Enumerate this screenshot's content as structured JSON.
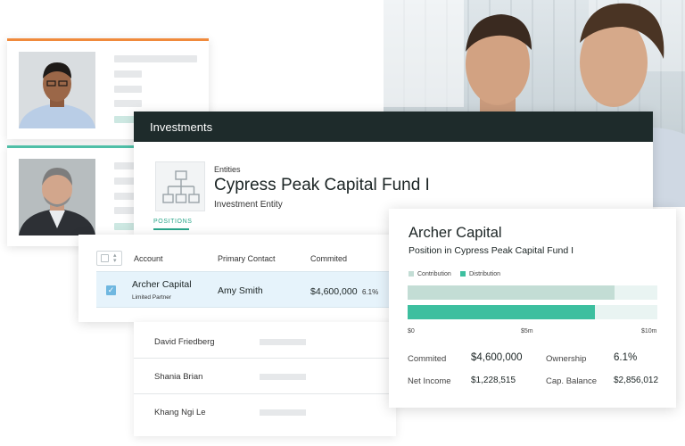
{
  "investments": {
    "title": "Investments",
    "entities_label": "Entities",
    "fund_name": "Cypress Peak Capital Fund I",
    "entity_type": "Investment Entity",
    "tab_positions": "POSITIONS"
  },
  "table": {
    "columns": [
      "Account",
      "Primary Contact",
      "Commited"
    ],
    "selected_row": {
      "account": "Archer Capital",
      "account_type": "Limited Partner",
      "contact": "Amy Smith",
      "commited": "$4,600,000",
      "pct": "6.1%"
    }
  },
  "list": [
    "David Friedberg",
    "Shania Brian",
    "Khang Ngi Le"
  ],
  "detail": {
    "title": "Archer Capital",
    "subtitle": "Position in Cypress Peak Capital Fund I",
    "legend": {
      "contribution": "Contribution",
      "distribution": "Distribution"
    },
    "contribution_color": "#c3ddd5",
    "distribution_color": "#3dbf9f",
    "contribution_fraction": 0.83,
    "distribution_fraction": 0.75,
    "ticks": [
      "$0",
      "$5m",
      "$10m"
    ],
    "stats": {
      "commited_label": "Commited",
      "commited_value": "$4,600,000",
      "ownership_label": "Ownership",
      "ownership_value": "6.1%",
      "net_income_label": "Net Income",
      "net_income_value": "$1,228,515",
      "cap_balance_label": "Cap. Balance",
      "cap_balance_value": "$2,856,012"
    }
  },
  "colors": {
    "header": "#1e2b2b",
    "accent": "#2aa58a",
    "orange": "#f08a3c",
    "teal": "#4fbfa7"
  }
}
